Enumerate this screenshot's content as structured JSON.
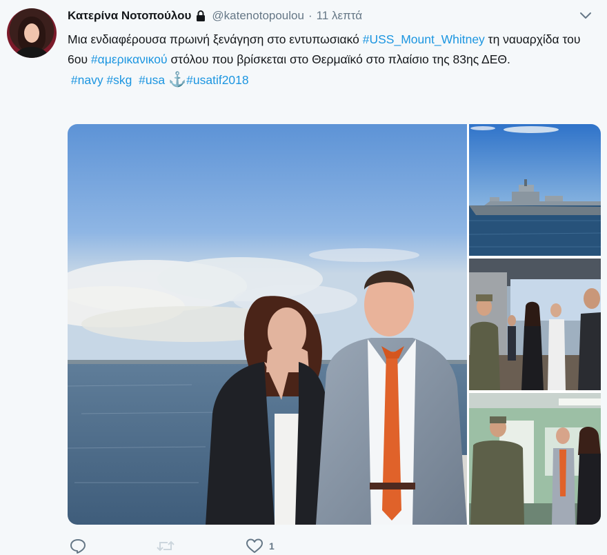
{
  "tweet": {
    "author_name": "Κατερίνα Νοτοπούλου",
    "handle": "@katenotopoulou",
    "separator": "·",
    "time": "11 λεπτά",
    "text_parts": {
      "p1": "Μια ενδιαφέρουσα πρωινή ξενάγηση στο εντυπωσιακό ",
      "h1": "#USS_Mount_Whitney",
      "p2": " τη ναυαρχίδα του 6ου ",
      "h2": "#αμερικανικού",
      "p3": " στόλου που βρίσκεται στο Θερμαϊκό στο πλαίσιο της 83ης ΔΕΘ.",
      "h3": "#navy",
      "h4": "#skg",
      "h5": "#usa",
      "anchor": "⚓",
      "h6": "#usatif2018"
    },
    "like_count": "1"
  },
  "icons": {
    "lock": "lock-icon",
    "caret": "chevron-down-icon",
    "reply": "reply-icon",
    "retweet": "retweet-icon",
    "like": "heart-icon"
  },
  "colors": {
    "link": "#1b95e0",
    "secondary_text": "#657786",
    "background": "#f5f8fa"
  }
}
